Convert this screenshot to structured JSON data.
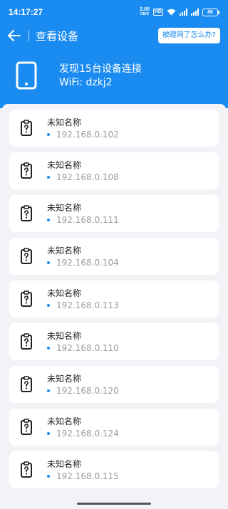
{
  "status_bar": {
    "time": "14:17:27",
    "net_speed_value": "2.00",
    "net_speed_unit": "KB/S",
    "hd_badge": "HD",
    "battery": "86"
  },
  "header": {
    "title": "查看设备",
    "help_button": "被蹭网了怎么办?"
  },
  "summary": {
    "found_text": "发现15台设备连接",
    "wifi_text": "WiFi: dzkj2"
  },
  "devices": [
    {
      "name": "未知名称",
      "ip": "192.168.0.102"
    },
    {
      "name": "未知名称",
      "ip": "192.168.0.108"
    },
    {
      "name": "未知名称",
      "ip": "192.168.0.111"
    },
    {
      "name": "未知名称",
      "ip": "192.168.0.104"
    },
    {
      "name": "未知名称",
      "ip": "192.168.0.113"
    },
    {
      "name": "未知名称",
      "ip": "192.168.0.110"
    },
    {
      "name": "未知名称",
      "ip": "192.168.0.120"
    },
    {
      "name": "未知名称",
      "ip": "192.168.0.124"
    },
    {
      "name": "未知名称",
      "ip": "192.168.0.115"
    }
  ],
  "colors": {
    "accent": "#1a8bf0",
    "background": "#f2f3f7",
    "card": "#ffffff",
    "ip_text": "#9a9a9a"
  },
  "icons": {
    "back": "arrow-left-icon",
    "phone": "phone-icon",
    "device": "device-unknown-icon"
  }
}
